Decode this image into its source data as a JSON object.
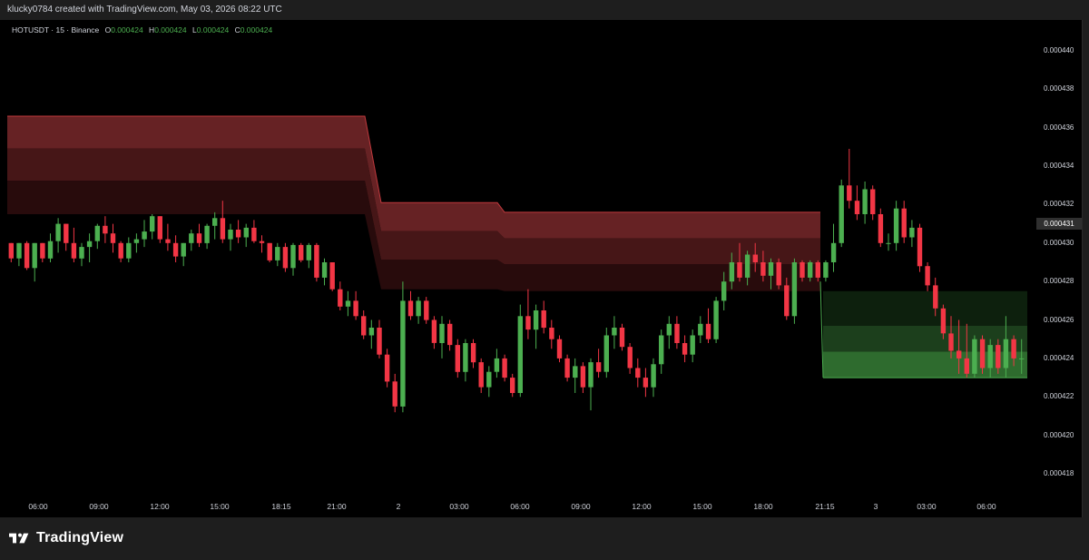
{
  "header": {
    "credit": "klucky0784 created with TradingView.com, May 03, 2026 08:22 UTC"
  },
  "legend": {
    "symbol": "HOTUSDT · 15 · Binance",
    "o_label": "O",
    "o_value": "0.000424",
    "h_label": "H",
    "h_value": "0.000424",
    "l_label": "L",
    "l_value": "0.000424",
    "c_label": "C",
    "c_value": "0.000424"
  },
  "price_tag": "0.000431",
  "footer": {
    "brand": "TradingView",
    "logo_icon": "tradingview-logo-icon"
  },
  "colors": {
    "up": "#4caf50",
    "down": "#f23645",
    "zone_red": "#6b1f1f",
    "zone_green": "#2e6b2e"
  },
  "chart_data": {
    "type": "candlestick",
    "ylim": [
      0.000417,
      0.000441
    ],
    "y_ticks": [
      "0.000440",
      "0.000438",
      "0.000436",
      "0.000434",
      "0.000432",
      "0.000430",
      "0.000428",
      "0.000426",
      "0.000424",
      "0.000422",
      "0.000420",
      "0.000418"
    ],
    "x_ticks": [
      "06:00",
      "09:00",
      "12:00",
      "15:00",
      "18:15",
      "21:00",
      "2",
      "03:00",
      "06:00",
      "09:00",
      "12:00",
      "15:00",
      "18:00",
      "21:15",
      "3",
      "03:00",
      "06:00"
    ],
    "resistance_zone": {
      "outer": [
        0.0004366,
        0.0004366,
        0.0004366,
        0.0004321,
        0.0004321,
        0.0004316,
        0.0004316,
        0.0004316
      ],
      "inner": [
        0.0004315,
        0.0004315,
        0.0004315,
        0.0004276,
        0.0004276,
        0.0004275,
        0.0004275,
        0.0004275
      ]
    },
    "support_zone": {
      "top": 0.0004275,
      "bottom": 0.000423
    },
    "candles": [
      [
        0.00043,
        0.00043,
        0.000429,
        0.0004292
      ],
      [
        0.0004292,
        0.00043,
        0.0004288,
        0.00043
      ],
      [
        0.00043,
        0.0004301,
        0.0004286,
        0.0004287
      ],
      [
        0.0004287,
        0.00043,
        0.000428,
        0.00043
      ],
      [
        0.00043,
        0.00043,
        0.000429,
        0.0004292
      ],
      [
        0.0004292,
        0.0004305,
        0.000429,
        0.0004301
      ],
      [
        0.0004301,
        0.0004313,
        0.0004295,
        0.000431
      ],
      [
        0.000431,
        0.000431,
        0.0004296,
        0.00043
      ],
      [
        0.00043,
        0.0004308,
        0.000429,
        0.0004292
      ],
      [
        0.0004292,
        0.00043,
        0.0004288,
        0.0004298
      ],
      [
        0.0004298,
        0.0004305,
        0.000429,
        0.0004301
      ],
      [
        0.0004301,
        0.000431,
        0.0004297,
        0.0004309
      ],
      [
        0.0004309,
        0.0004314,
        0.00043,
        0.0004305
      ],
      [
        0.0004305,
        0.000431,
        0.0004295,
        0.00043
      ],
      [
        0.00043,
        0.0004301,
        0.000429,
        0.0004292
      ],
      [
        0.0004292,
        0.0004303,
        0.000429,
        0.00043
      ],
      [
        0.00043,
        0.0004305,
        0.0004295,
        0.0004302
      ],
      [
        0.0004302,
        0.0004312,
        0.0004298,
        0.0004306
      ],
      [
        0.0004306,
        0.0004315,
        0.0004302,
        0.0004314
      ],
      [
        0.0004314,
        0.0004314,
        0.00043,
        0.0004302
      ],
      [
        0.0004302,
        0.000431,
        0.0004296,
        0.00043
      ],
      [
        0.00043,
        0.0004304,
        0.000429,
        0.0004293
      ],
      [
        0.0004293,
        0.00043,
        0.0004288,
        0.00043
      ],
      [
        0.00043,
        0.0004307,
        0.0004296,
        0.0004305
      ],
      [
        0.0004305,
        0.000431,
        0.0004298,
        0.00043
      ],
      [
        0.00043,
        0.000431,
        0.0004297,
        0.0004309
      ],
      [
        0.0004309,
        0.0004316,
        0.0004302,
        0.0004313
      ],
      [
        0.0004313,
        0.0004322,
        0.00043,
        0.0004302
      ],
      [
        0.0004302,
        0.000431,
        0.0004296,
        0.0004307
      ],
      [
        0.0004307,
        0.0004312,
        0.00043,
        0.0004303
      ],
      [
        0.0004303,
        0.000431,
        0.0004298,
        0.0004308
      ],
      [
        0.0004308,
        0.0004312,
        0.00043,
        0.0004301
      ],
      [
        0.0004301,
        0.0004304,
        0.0004295,
        0.00043
      ],
      [
        0.00043,
        0.00043,
        0.000429,
        0.0004291
      ],
      [
        0.0004291,
        0.00043,
        0.0004288,
        0.0004298
      ],
      [
        0.0004298,
        0.00043,
        0.0004285,
        0.0004287
      ],
      [
        0.0004287,
        0.00043,
        0.0004283,
        0.0004299
      ],
      [
        0.0004299,
        0.00043,
        0.000429,
        0.0004291
      ],
      [
        0.0004291,
        0.00043,
        0.0004287,
        0.0004299
      ],
      [
        0.0004299,
        0.00043,
        0.000428,
        0.0004282
      ],
      [
        0.0004282,
        0.0004292,
        0.0004278,
        0.000429
      ],
      [
        0.000429,
        0.000429,
        0.0004275,
        0.0004276
      ],
      [
        0.0004276,
        0.000428,
        0.0004265,
        0.0004267
      ],
      [
        0.0004267,
        0.0004275,
        0.0004262,
        0.000427
      ],
      [
        0.000427,
        0.0004275,
        0.000426,
        0.0004262
      ],
      [
        0.0004262,
        0.0004265,
        0.000425,
        0.0004252
      ],
      [
        0.0004252,
        0.000426,
        0.0004245,
        0.0004256
      ],
      [
        0.0004256,
        0.000426,
        0.000424,
        0.0004242
      ],
      [
        0.0004242,
        0.0004245,
        0.0004225,
        0.0004228
      ],
      [
        0.0004228,
        0.0004232,
        0.0004212,
        0.0004215
      ],
      [
        0.0004215,
        0.000428,
        0.0004212,
        0.000427
      ],
      [
        0.000427,
        0.0004275,
        0.000426,
        0.0004262
      ],
      [
        0.0004262,
        0.0004272,
        0.0004258,
        0.000427
      ],
      [
        0.000427,
        0.0004272,
        0.0004258,
        0.000426
      ],
      [
        0.000426,
        0.0004262,
        0.0004245,
        0.0004248
      ],
      [
        0.0004248,
        0.0004262,
        0.000424,
        0.0004258
      ],
      [
        0.0004258,
        0.000426,
        0.0004244,
        0.0004247
      ],
      [
        0.0004247,
        0.000425,
        0.000423,
        0.0004233
      ],
      [
        0.0004233,
        0.000425,
        0.0004228,
        0.0004248
      ],
      [
        0.0004248,
        0.000425,
        0.0004235,
        0.0004238
      ],
      [
        0.0004238,
        0.000424,
        0.0004222,
        0.0004225
      ],
      [
        0.0004225,
        0.0004236,
        0.000422,
        0.0004233
      ],
      [
        0.0004233,
        0.0004245,
        0.000423,
        0.000424
      ],
      [
        0.000424,
        0.0004242,
        0.0004228,
        0.000423
      ],
      [
        0.000423,
        0.0004232,
        0.000422,
        0.0004222
      ],
      [
        0.0004222,
        0.0004268,
        0.000422,
        0.0004262
      ],
      [
        0.0004262,
        0.0004276,
        0.000425,
        0.0004255
      ],
      [
        0.0004255,
        0.0004268,
        0.0004245,
        0.0004265
      ],
      [
        0.0004265,
        0.000427,
        0.0004253,
        0.0004256
      ],
      [
        0.0004256,
        0.000426,
        0.0004245,
        0.000425
      ],
      [
        0.000425,
        0.0004252,
        0.0004238,
        0.000424
      ],
      [
        0.000424,
        0.0004242,
        0.0004228,
        0.000423
      ],
      [
        0.000423,
        0.000424,
        0.0004222,
        0.0004236
      ],
      [
        0.0004236,
        0.0004238,
        0.0004222,
        0.0004225
      ],
      [
        0.0004225,
        0.000424,
        0.0004213,
        0.0004238
      ],
      [
        0.0004238,
        0.0004245,
        0.000423,
        0.0004233
      ],
      [
        0.0004233,
        0.0004256,
        0.000423,
        0.0004252
      ],
      [
        0.0004252,
        0.0004262,
        0.0004245,
        0.0004256
      ],
      [
        0.0004256,
        0.0004258,
        0.0004244,
        0.0004246
      ],
      [
        0.0004246,
        0.0004248,
        0.0004232,
        0.0004235
      ],
      [
        0.0004235,
        0.000424,
        0.0004225,
        0.000423
      ],
      [
        0.000423,
        0.0004235,
        0.000422,
        0.0004225
      ],
      [
        0.0004225,
        0.000424,
        0.000422,
        0.0004237
      ],
      [
        0.0004237,
        0.0004255,
        0.0004232,
        0.0004252
      ],
      [
        0.0004252,
        0.0004262,
        0.0004245,
        0.0004258
      ],
      [
        0.0004258,
        0.0004262,
        0.0004245,
        0.0004248
      ],
      [
        0.0004248,
        0.0004252,
        0.0004238,
        0.0004242
      ],
      [
        0.0004242,
        0.0004255,
        0.0004238,
        0.0004252
      ],
      [
        0.0004252,
        0.0004262,
        0.0004248,
        0.0004258
      ],
      [
        0.0004258,
        0.0004266,
        0.0004248,
        0.000425
      ],
      [
        0.000425,
        0.0004272,
        0.0004248,
        0.000427
      ],
      [
        0.000427,
        0.0004285,
        0.0004265,
        0.000428
      ],
      [
        0.000428,
        0.0004295,
        0.0004276,
        0.000429
      ],
      [
        0.000429,
        0.00043,
        0.000428,
        0.0004282
      ],
      [
        0.0004282,
        0.0004296,
        0.0004278,
        0.0004294
      ],
      [
        0.0004294,
        0.00043,
        0.0004285,
        0.000429
      ],
      [
        0.000429,
        0.0004296,
        0.000428,
        0.0004283
      ],
      [
        0.0004283,
        0.0004292,
        0.0004276,
        0.000429
      ],
      [
        0.000429,
        0.0004292,
        0.0004276,
        0.0004278
      ],
      [
        0.0004278,
        0.0004282,
        0.000426,
        0.0004262
      ],
      [
        0.0004262,
        0.0004292,
        0.0004258,
        0.000429
      ],
      [
        0.000429,
        0.0004291,
        0.000428,
        0.0004282
      ],
      [
        0.0004282,
        0.0004291,
        0.000428,
        0.000429
      ],
      [
        0.000429,
        0.0004291,
        0.000428,
        0.0004282
      ],
      [
        0.0004282,
        0.0004291,
        0.000428,
        0.000429
      ],
      [
        0.000429,
        0.000431,
        0.0004285,
        0.00043
      ],
      [
        0.00043,
        0.0004333,
        0.0004298,
        0.000433
      ],
      [
        0.000433,
        0.0004349,
        0.0004318,
        0.0004322
      ],
      [
        0.0004322,
        0.000433,
        0.0004312,
        0.0004315
      ],
      [
        0.0004315,
        0.0004332,
        0.000431,
        0.0004328
      ],
      [
        0.0004328,
        0.000433,
        0.0004312,
        0.0004315
      ],
      [
        0.0004315,
        0.0004318,
        0.0004298,
        0.00043
      ],
      [
        0.00043,
        0.0004305,
        0.0004296,
        0.00043
      ],
      [
        0.00043,
        0.0004322,
        0.0004296,
        0.0004318
      ],
      [
        0.0004318,
        0.0004322,
        0.00043,
        0.0004303
      ],
      [
        0.0004303,
        0.0004312,
        0.0004298,
        0.0004308
      ],
      [
        0.0004308,
        0.000431,
        0.0004285,
        0.0004288
      ],
      [
        0.0004288,
        0.000429,
        0.0004275,
        0.0004278
      ],
      [
        0.0004278,
        0.0004282,
        0.0004262,
        0.0004266
      ],
      [
        0.0004266,
        0.0004268,
        0.000425,
        0.0004253
      ],
      [
        0.0004253,
        0.0004262,
        0.000424,
        0.0004244
      ],
      [
        0.0004244,
        0.000426,
        0.0004232,
        0.000424
      ],
      [
        0.000424,
        0.0004258,
        0.000423,
        0.0004232
      ],
      [
        0.0004232,
        0.0004252,
        0.000423,
        0.000425
      ],
      [
        0.000425,
        0.0004252,
        0.0004232,
        0.0004235
      ],
      [
        0.0004235,
        0.000425,
        0.000423,
        0.0004247
      ],
      [
        0.0004247,
        0.000425,
        0.0004232,
        0.0004235
      ],
      [
        0.0004235,
        0.0004262,
        0.000423,
        0.000425
      ],
      [
        0.000425,
        0.0004252,
        0.0004236,
        0.000424
      ],
      [
        0.000424,
        0.000425,
        0.0004232,
        0.000424
      ]
    ]
  }
}
